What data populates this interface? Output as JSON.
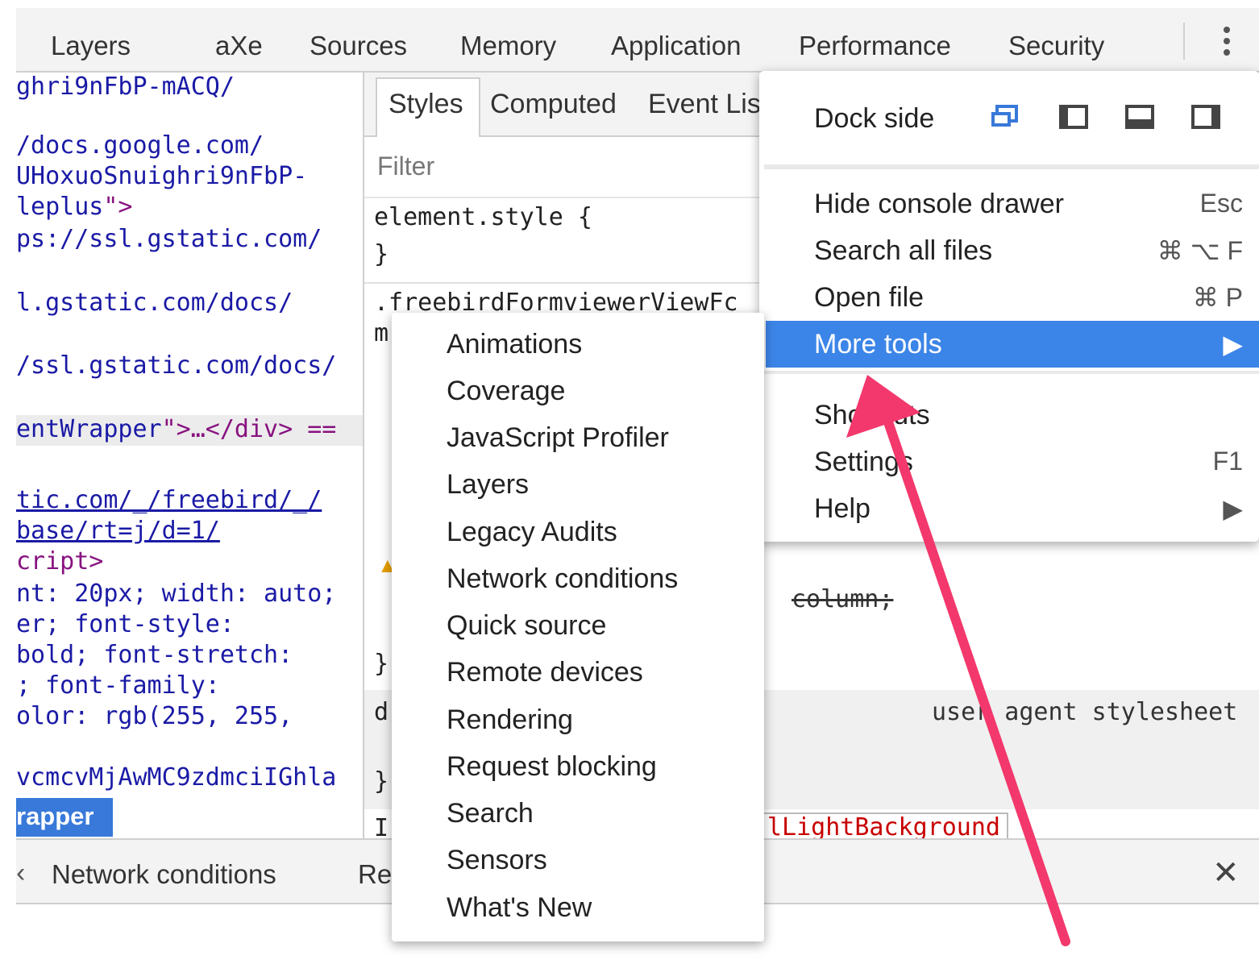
{
  "top_tabs": [
    "Layers",
    "aXe",
    "Sources",
    "Memory",
    "Application",
    "Performance",
    "Security"
  ],
  "elements_code": {
    "l1": "ghri9nFbP-mACQ/",
    "l2": "/docs.google.com/",
    "l3": "UHoxuoSnuighri9nFbP-",
    "l4_text": "leplus",
    "l4_tail": "\">",
    "l5": "ps://ssl.gstatic.com/",
    "l6": "l.gstatic.com/docs/",
    "l7": "/ssl.gstatic.com/docs/",
    "l8_text": "entWrapper",
    "l8_tail": "\">…</div> ==",
    "l9": "tic.com/_/freebird/_/",
    "l10": "base/rt=j/d=1/",
    "l11": "cript>",
    "l12": "nt: 20px; width: auto;",
    "l13": "er; font-style:",
    "l14": " bold; font-stretch:",
    "l15": "; font-family:",
    "l16": "olor: rgb(255, 255,",
    "l17": "vcmcvMjAwMC9zdmciIGhla",
    "wrapper_badge": "rapper"
  },
  "styles_tabs": {
    "styles": "Styles",
    "computed": "Computed",
    "event": "Event Lis"
  },
  "styles_pane": {
    "filter_placeholder": "Filter",
    "element_style_open": "element.style {",
    "close_brace": "}",
    "selector": ".freebirdFormviewerViewFc",
    "m_char": "m",
    "strike_prop": "column;",
    "brace2": "}",
    "d_char": "d",
    "ua_label": "user agent stylesheet",
    "brace3": "}",
    "in_char": "Ir",
    "light_bg": "lLightBackground"
  },
  "drawer": {
    "left_arrow": "‹",
    "tab1": "Network conditions",
    "tab2": "Re",
    "close": "✕"
  },
  "main_menu": {
    "dock_label": "Dock side",
    "items": [
      {
        "label": "Hide console drawer",
        "shortcut": "Esc"
      },
      {
        "label": "Search all files",
        "shortcut": "⌘ ⌥ F"
      },
      {
        "label": "Open file",
        "shortcut": "⌘ P"
      },
      {
        "label": "More tools",
        "shortcut": "▶"
      },
      {
        "label": "Shortcuts",
        "shortcut": ""
      },
      {
        "label": "Settings",
        "shortcut": "F1"
      },
      {
        "label": "Help",
        "shortcut": "▶"
      }
    ]
  },
  "submenu": {
    "items": [
      "Animations",
      "Coverage",
      "JavaScript Profiler",
      "Layers",
      "Legacy Audits",
      "Network conditions",
      "Quick source",
      "Remote devices",
      "Rendering",
      "Request blocking",
      "Search",
      "Sensors",
      "What's New"
    ]
  },
  "colors": {
    "accent": "#3c85e8",
    "arrow": "#f2386c",
    "dock_active": "#3879d9"
  },
  "icons": {
    "kebab": "kebab-menu-icon",
    "dock": [
      "undock-icon",
      "dock-left-icon",
      "dock-bottom-icon",
      "dock-right-icon"
    ],
    "warning": "warning-icon",
    "close": "close-icon"
  }
}
